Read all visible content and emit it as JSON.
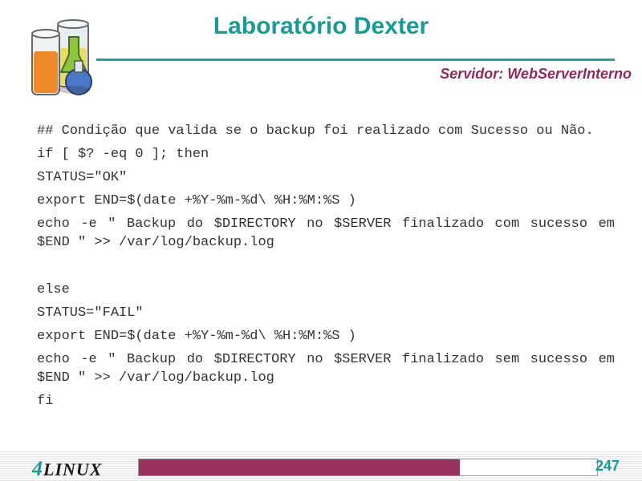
{
  "header": {
    "title": "Laboratório Dexter",
    "subtitle": "Servidor: WebServerInterno",
    "colors": {
      "title": "#1a9a96",
      "subtitle": "#8e2a5c",
      "rule": "#22a19d"
    }
  },
  "code": {
    "lines": [
      "## Condição que valida se o backup foi realizado com Sucesso ou Não.",
      "if [ $? -eq 0 ]; then",
      "STATUS=\"OK\"",
      "export END=$(date +%Y-%m-%d\\ %H:%M:%S )",
      "echo -e \" Backup do $DIRECTORY no $SERVER finalizado com sucesso em  $END \" >> /var/log/backup.log",
      "",
      "else",
      "STATUS=\"FAIL\"",
      "export END=$(date +%Y-%m-%d\\ %H:%M:%S )",
      "echo -e \" Backup do $DIRECTORY no $SERVER finalizado sem sucesso em  $END \" >> /var/log/backup.log",
      "fi"
    ]
  },
  "footer": {
    "brand_number": "4",
    "brand_text": "LINUX",
    "page_number": "247",
    "progress_fraction": 0.7,
    "colors": {
      "progress": "#98325f",
      "page_number": "#1a9a96"
    }
  },
  "icons": {
    "logo": "lab-flasks-icon"
  }
}
